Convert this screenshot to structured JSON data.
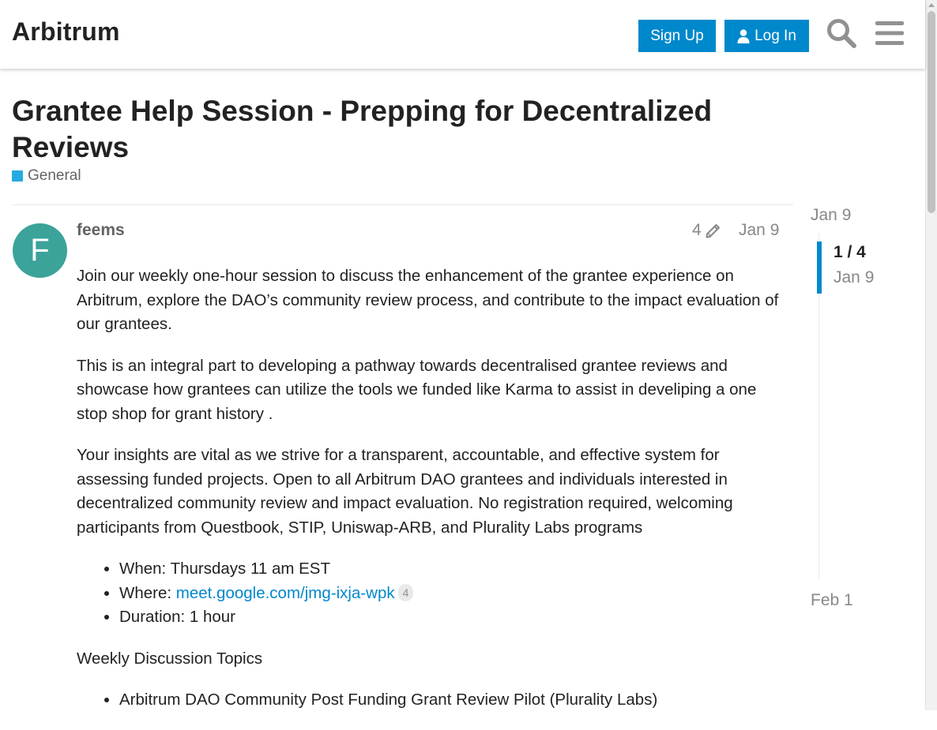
{
  "header": {
    "site_title": "Arbitrum",
    "signup_label": "Sign Up",
    "login_label": "Log In",
    "icons": [
      "user-icon",
      "search-icon",
      "hamburger-menu-icon"
    ]
  },
  "topic": {
    "title": "Grantee Help Session - Prepping for Decentralized Reviews",
    "category": "General",
    "category_color": "#25aae1"
  },
  "post": {
    "avatar_letter": "F",
    "avatar_color": "#3ba39a",
    "username": "feems",
    "edit_count": "4",
    "date": "Jan 9",
    "paragraphs": [
      "Join our weekly one-hour session to discuss the enhancement of the grantee experience on Arbitrum, explore the DAO’s community review process, and contribute to the impact evaluation of our grantees.",
      "This is an integral part to developing a pathway towards decentralised grantee reviews and showcase how grantees can utilize the tools we funded like Karma to assist in develiping a one stop shop for grant history .",
      "Your insights are vital as we strive for a transparent, accountable, and effective system for assessing funded projects. Open to all Arbitrum DAO grantees and individuals interested in decentralized community review and impact evaluation. No registration required, welcoming participants from Questbook, STIP, Uniswap-ARB, and Plurality Labs programs"
    ],
    "details": {
      "when": "When: Thursdays 11 am EST",
      "where_label": "Where: ",
      "where_link": "meet.google.com/jmg-ixja-wpk",
      "where_clicks": "4",
      "duration": "Duration: 1 hour"
    },
    "topics_heading": "Weekly Discussion Topics",
    "topics": [
      "Arbitrum DAO Community Post Funding Grant Review Pilot (Plurality Labs)"
    ]
  },
  "timeline": {
    "start_date": "Jan 9",
    "progress": "1 / 4",
    "current_date": "Jan 9",
    "end_date": "Feb 1"
  },
  "colors": {
    "accent": "#0088cc",
    "text": "#222222",
    "muted": "#888888"
  }
}
